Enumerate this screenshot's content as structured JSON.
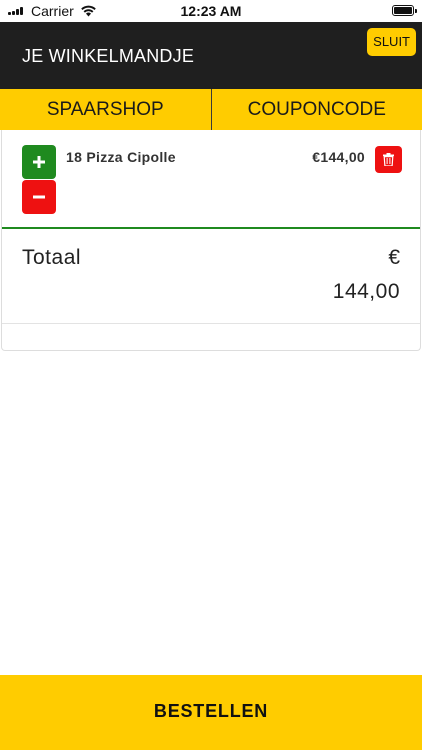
{
  "status_bar": {
    "carrier": "Carrier",
    "time": "12:23 AM",
    "signal_icon": "signal-icon",
    "wifi_icon": "wifi-icon",
    "battery_icon": "battery-icon",
    "battery_level": 1.0
  },
  "header": {
    "title": "JE WINKELMANDJE",
    "close_label": "SLUIT"
  },
  "tabs": [
    {
      "label": "SPAARSHOP"
    },
    {
      "label": "COUPONCODE"
    }
  ],
  "cart": {
    "items": [
      {
        "quantity_name": "18 Pizza Cipolle",
        "price": "€144,00",
        "plus_icon": "plus-icon",
        "minus_icon": "minus-icon",
        "delete_icon": "trash-icon"
      }
    ],
    "total_label": "Totaal",
    "total_currency": "€",
    "total_value": "144,00"
  },
  "footer": {
    "order_label": "BESTELLEN"
  },
  "colors": {
    "accent_yellow": "#ffcc00",
    "header_dark": "#1f1f1f",
    "plus_green": "#1f8a1f",
    "danger_red": "#ee1111"
  }
}
